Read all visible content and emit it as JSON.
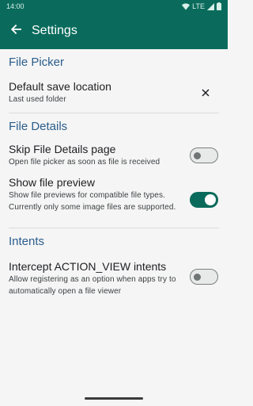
{
  "status_bar": {
    "time": "14:00",
    "network": "LTE"
  },
  "app_bar": {
    "title": "Settings"
  },
  "sections": {
    "file_picker": {
      "header": "File Picker",
      "default_save": {
        "title": "Default save location",
        "summary": "Last used folder"
      }
    },
    "file_details": {
      "header": "File Details",
      "skip_details": {
        "title": "Skip File Details page",
        "summary": "Open file picker as soon as file is received",
        "enabled": false
      },
      "show_preview": {
        "title": "Show file preview",
        "summary": "Show file previews for compatible file types. Currently only some image files are supported.",
        "enabled": true
      }
    },
    "intents": {
      "header": "Intents",
      "intercept": {
        "title": "Intercept ACTION_VIEW intents",
        "summary": "Allow registering as an option when apps try to automatically open a file viewer",
        "enabled": false
      }
    }
  },
  "colors": {
    "primary": "#0a6b5c",
    "section_header": "#2b5d8c",
    "background": "#f5f5f5"
  },
  "icons": [
    "wifi-icon",
    "signal-icon",
    "battery-icon",
    "back-arrow-icon",
    "close-icon"
  ]
}
